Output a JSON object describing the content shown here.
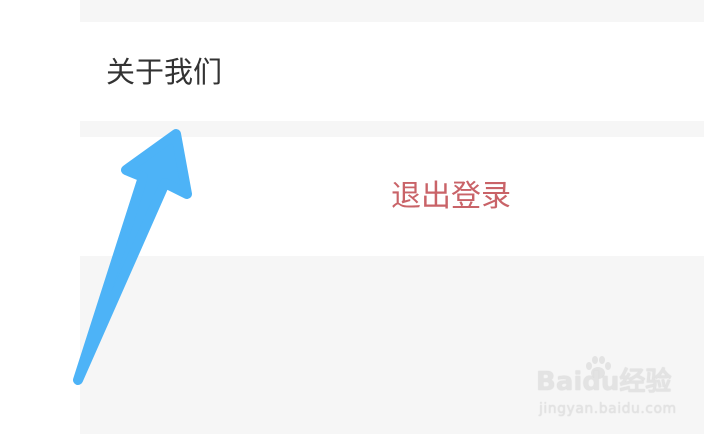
{
  "settings": {
    "about_label": "关于我们",
    "logout_label": "退出登录"
  },
  "annotation": {
    "arrow_icon": "pointer-arrow-icon",
    "arrow_color": "#4db3f7"
  },
  "watermark": {
    "logo_text": "Baidu经验",
    "url_text": "jingyan.baidu.com"
  }
}
